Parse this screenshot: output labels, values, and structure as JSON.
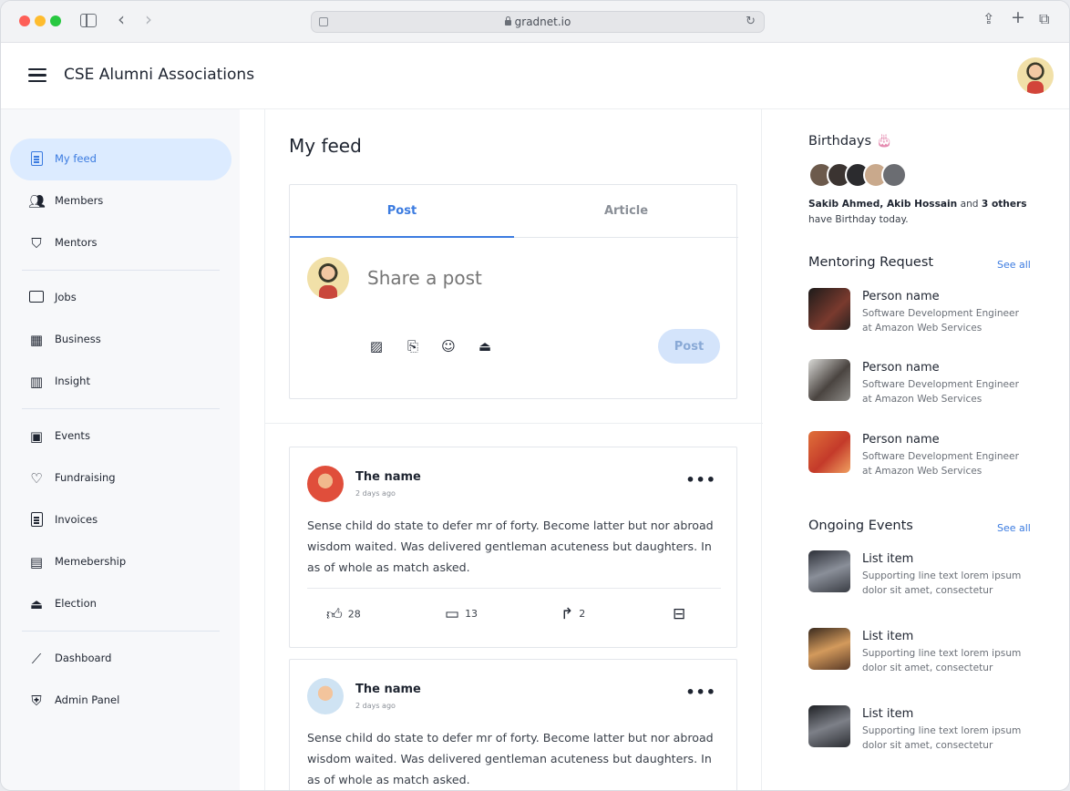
{
  "browser": {
    "url": "gradnet.io"
  },
  "header": {
    "title": "CSE Alumni Associations"
  },
  "sidebar": {
    "items": [
      {
        "label": "My feed",
        "icon": "feed-icon"
      },
      {
        "label": "Members",
        "icon": "members-icon"
      },
      {
        "label": "Mentors",
        "icon": "mentors-icon"
      },
      {
        "label": "Jobs",
        "icon": "briefcase-icon"
      },
      {
        "label": "Business",
        "icon": "store-icon"
      },
      {
        "label": "Insight",
        "icon": "chart-icon"
      },
      {
        "label": "Events",
        "icon": "calendar-icon"
      },
      {
        "label": "Fundraising",
        "icon": "hand-heart-icon"
      },
      {
        "label": "Invoices",
        "icon": "invoice-icon"
      },
      {
        "label": "Memebership",
        "icon": "id-card-icon"
      },
      {
        "label": "Election",
        "icon": "ballot-icon"
      },
      {
        "label": "Dashboard",
        "icon": "sparkline-icon"
      },
      {
        "label": "Admin Panel",
        "icon": "shield-icon"
      }
    ]
  },
  "feed": {
    "title": "My feed",
    "composer": {
      "tabs": [
        "Post",
        "Article"
      ],
      "placeholder": "Share a post",
      "post_label": "Post"
    },
    "posts": [
      {
        "name": "The name",
        "time": "2 days ago",
        "body": "Sense child do state to defer mr of forty. Become latter but nor abroad wisdom waited. Was delivered gentleman acuteness but daughters. In as of whole as match asked.",
        "likes": "28",
        "comments": "13",
        "shares": "2"
      },
      {
        "name": "The name",
        "time": "2 days ago",
        "body": "Sense child do state to defer mr of forty. Become latter but nor abroad wisdom waited. Was delivered gentleman acuteness but daughters. In as of whole as match asked."
      }
    ]
  },
  "right": {
    "birthdays": {
      "title": "Birthdays",
      "names": "Sakib Ahmed, Akib Hossain",
      "and": "and",
      "others": "3 others",
      "suffix": "have Birthday today."
    },
    "mentoring": {
      "title": "Mentoring Request",
      "see_all": "See all",
      "items": [
        {
          "name": "Person name",
          "role": "Software Development Engineer",
          "company": "at Amazon Web Services"
        },
        {
          "name": "Person name",
          "role": "Software Development Engineer",
          "company": "at Amazon Web Services"
        },
        {
          "name": "Person name",
          "role": "Software Development Engineer",
          "company": "at Amazon Web Services"
        }
      ]
    },
    "events": {
      "title": "Ongoing Events",
      "see_all": "See all",
      "items": [
        {
          "name": "List item",
          "line1": "Supporting line text lorem ipsum",
          "line2": "dolor sit amet, consectetur"
        },
        {
          "name": "List item",
          "line1": "Supporting line text lorem ipsum",
          "line2": "dolor sit amet, consectetur"
        },
        {
          "name": "List item",
          "line1": "Supporting line text lorem ipsum",
          "line2": "dolor sit amet, consectetur"
        }
      ]
    }
  },
  "colors": {
    "accent": "#3b7be0",
    "active_nav_bg": "#dcebff",
    "post_button_bg": "#d4e4fb"
  }
}
